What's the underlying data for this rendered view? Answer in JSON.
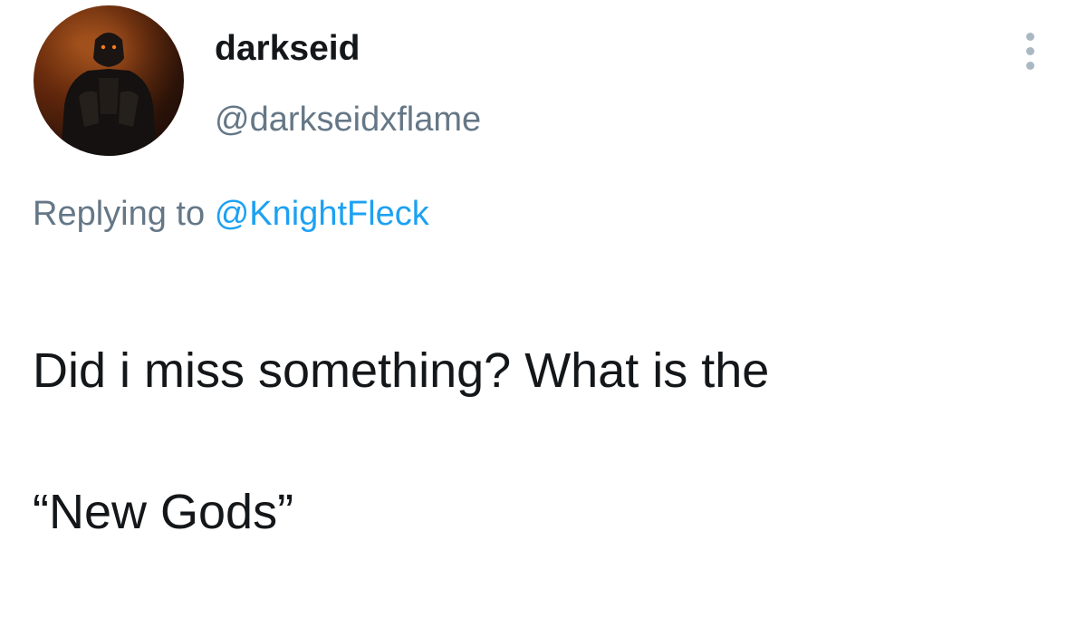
{
  "tweet": {
    "display_name": "darkseid",
    "handle": "@darkseidxflame",
    "replying_prefix": "Replying to",
    "replying_to": "@KnightFleck",
    "text_line1": "Did i miss something? What is the",
    "text_line2": "“New Gods”",
    "more_icon": "more-vertical-icon",
    "accent_color": "#1da1f2",
    "muted_color": "#657786",
    "text_color": "#14171a"
  }
}
